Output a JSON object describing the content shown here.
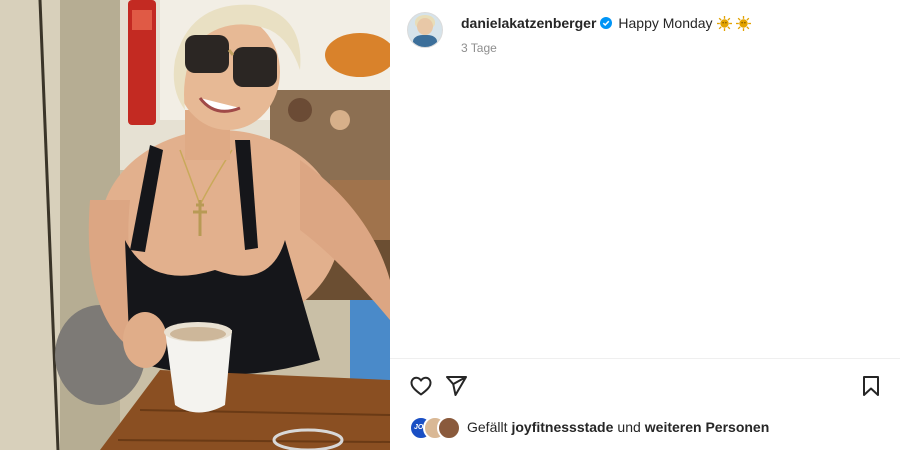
{
  "post": {
    "username": "danielakatzenberger",
    "caption": "Happy Monday",
    "caption_emojis": [
      "sun-emoji",
      "sun-emoji"
    ],
    "timestamp": "3 Tage",
    "verified": true
  },
  "likes": {
    "prefix": "Gefällt",
    "first_user": "joyfitnessstade",
    "connector": "und",
    "rest": "weiteren Personen",
    "avatar_badge_text": "JOY"
  },
  "actions": {
    "like_icon": "heart-icon",
    "share_icon": "send-icon",
    "save_icon": "bookmark-icon"
  },
  "colors": {
    "text": "#262626",
    "secondary": "#8e8e8e",
    "verified": "#0095f6",
    "divider": "#efefef"
  }
}
